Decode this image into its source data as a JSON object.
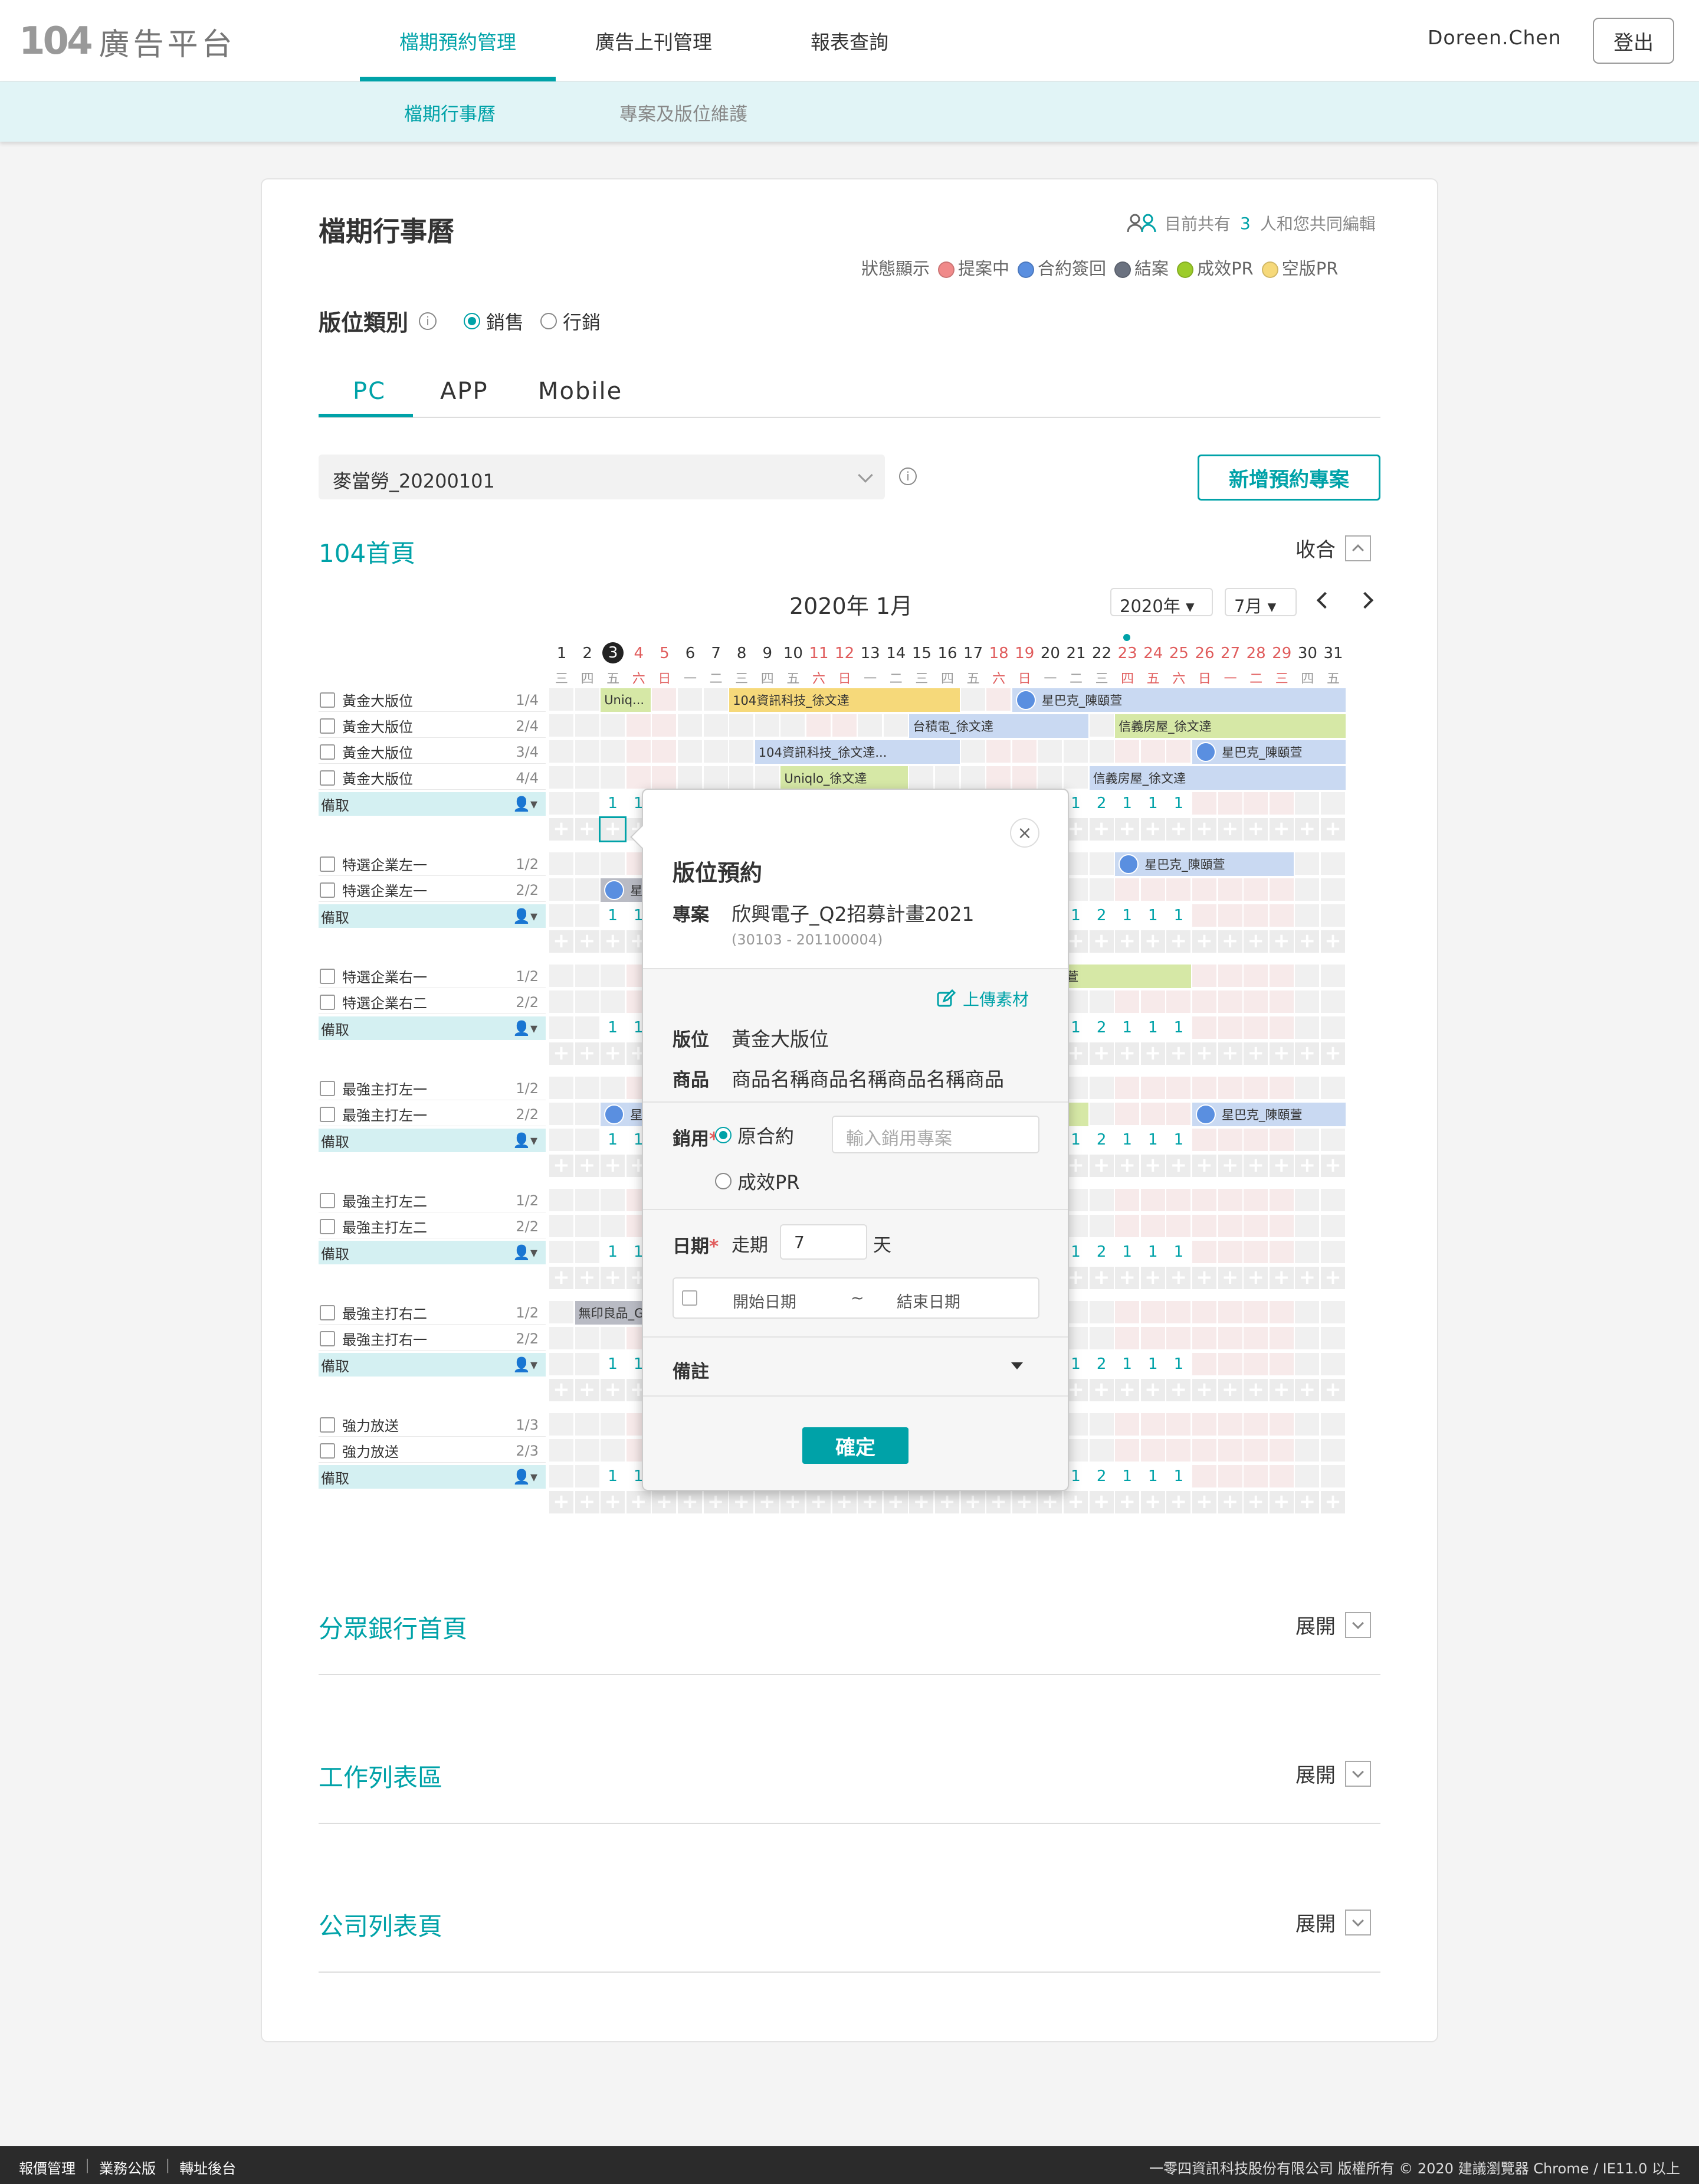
{
  "brand": {
    "num": "104",
    "name": "廣告平台"
  },
  "nav": {
    "items": [
      {
        "label": "檔期預約管理"
      },
      {
        "label": "廣告上刊管理"
      },
      {
        "label": "報表查詢"
      }
    ],
    "user": "Doreen.Chen",
    "logout": "登出"
  },
  "subnav": {
    "items": [
      {
        "label": "檔期行事曆"
      },
      {
        "label": "專案及版位維護"
      }
    ]
  },
  "page": {
    "title": "檔期行事曆",
    "collab_prefix": "目前共有",
    "collab_count": "3",
    "collab_suffix": "人和您共同編輯",
    "legend_title": "狀態顯示",
    "legend": [
      {
        "label": "提案中",
        "color": "#f08a8a"
      },
      {
        "label": "合約簽回",
        "color": "#5a8fe0"
      },
      {
        "label": "結案",
        "color": "#6b7280"
      },
      {
        "label": "成效PR",
        "color": "#9ccc2a"
      },
      {
        "label": "空版PR",
        "color": "#f6d97a"
      }
    ],
    "category_label": "版位類別",
    "category_options": [
      {
        "label": "銷售",
        "selected": true
      },
      {
        "label": "行銷",
        "selected": false
      }
    ],
    "tabs": [
      {
        "label": "PC"
      },
      {
        "label": "APP"
      },
      {
        "label": "Mobile"
      }
    ],
    "project_select": "麥當勞_20200101",
    "new_project": "新增預約專案"
  },
  "section": {
    "title": "104首頁",
    "toggle": "收合"
  },
  "calendar": {
    "title": "2020年 1月",
    "year": "2020年",
    "month": "7月",
    "days": [
      "1",
      "2",
      "3",
      "4",
      "5",
      "6",
      "7",
      "8",
      "9",
      "10",
      "11",
      "12",
      "13",
      "14",
      "15",
      "16",
      "17",
      "18",
      "19",
      "20",
      "21",
      "22",
      "23",
      "24",
      "25",
      "26",
      "27",
      "28",
      "29",
      "30",
      "31"
    ],
    "weekdays": [
      "三",
      "四",
      "五",
      "六",
      "日",
      "一",
      "二",
      "三",
      "四",
      "五",
      "六",
      "日",
      "一",
      "二",
      "三",
      "四",
      "五",
      "六",
      "日",
      "一",
      "二",
      "三",
      "四",
      "五",
      "六",
      "日",
      "一",
      "二",
      "三",
      "四",
      "五"
    ],
    "weekend": [
      3,
      4,
      10,
      11,
      17,
      18,
      22,
      23,
      24,
      25,
      26,
      27,
      28
    ],
    "today_index": 2,
    "groups": [
      {
        "rows": [
          {
            "name": "黃金大版位",
            "frac": "1/4"
          },
          {
            "name": "黃金大版位",
            "frac": "2/4"
          },
          {
            "name": "黃金大版位",
            "frac": "3/4"
          },
          {
            "name": "黃金大版位",
            "frac": "4/4"
          }
        ]
      },
      {
        "rows": [
          {
            "name": "特選企業左一",
            "frac": "1/2"
          },
          {
            "name": "特選企業左一",
            "frac": "2/2"
          }
        ]
      },
      {
        "rows": [
          {
            "name": "特選企業右一",
            "frac": "1/2"
          },
          {
            "name": "特選企業右二",
            "frac": "2/2"
          }
        ]
      },
      {
        "rows": [
          {
            "name": "最強主打左一",
            "frac": "1/2"
          },
          {
            "name": "最強主打左一",
            "frac": "2/2"
          }
        ]
      },
      {
        "rows": [
          {
            "name": "最強主打左二",
            "frac": "1/2"
          },
          {
            "name": "最強主打左二",
            "frac": "2/2"
          }
        ]
      },
      {
        "rows": [
          {
            "name": "最強主打右二",
            "frac": "1/2"
          },
          {
            "name": "最強主打右一",
            "frac": "2/2"
          }
        ]
      },
      {
        "rows": [
          {
            "name": "強力放送",
            "frac": "1/3"
          },
          {
            "name": "強力放送",
            "frac": "2/3"
          }
        ]
      }
    ],
    "spare_label": "備取",
    "spare_counts": [
      "1",
      "1",
      "2",
      "1",
      "1",
      "1"
    ],
    "bookings": [
      {
        "group": 0,
        "row": 0,
        "start": 3,
        "end": 4,
        "label": "Uniq...",
        "style": "b-g",
        "avatar": false
      },
      {
        "group": 0,
        "row": 0,
        "start": 8,
        "end": 16,
        "label": "104資訊科技_徐文達",
        "style": "b-y",
        "avatar": false
      },
      {
        "group": 0,
        "row": 0,
        "start": 19,
        "end": 31,
        "label": "星巴克_陳頤萱",
        "style": "b-b",
        "avatar": true
      },
      {
        "group": 0,
        "row": 1,
        "start": 15,
        "end": 21,
        "label": "台積電_徐文達",
        "style": "b-b",
        "avatar": false
      },
      {
        "group": 0,
        "row": 1,
        "start": 23,
        "end": 31,
        "label": "信義房屋_徐文達",
        "style": "b-g",
        "avatar": false
      },
      {
        "group": 0,
        "row": 2,
        "start": 9,
        "end": 16,
        "label": "104資訊科技_徐文達...",
        "style": "b-b",
        "avatar": false
      },
      {
        "group": 0,
        "row": 2,
        "start": 26,
        "end": 31,
        "label": "星巴克_陳頤萱",
        "style": "b-b",
        "avatar": true
      },
      {
        "group": 0,
        "row": 3,
        "start": 10,
        "end": 14,
        "label": "Uniqlo_徐文達",
        "style": "b-g",
        "avatar": false
      },
      {
        "group": 0,
        "row": 3,
        "start": 22,
        "end": 31,
        "label": "信義房屋_徐文達",
        "style": "b-b",
        "avatar": false
      },
      {
        "group": 1,
        "row": 0,
        "start": 23,
        "end": 29,
        "label": "星巴克_陳頤萱",
        "style": "b-b",
        "avatar": true
      },
      {
        "group": 1,
        "row": 1,
        "start": 3,
        "end": 4,
        "label": "星",
        "style": "b-d",
        "avatar": true
      },
      {
        "group": 2,
        "row": 0,
        "start": 20,
        "end": 25,
        "label": "陳頤萱",
        "style": "b-g",
        "avatar": false
      },
      {
        "group": 3,
        "row": 1,
        "start": 3,
        "end": 4,
        "label": "星",
        "style": "b-b",
        "avatar": true
      },
      {
        "group": 3,
        "row": 1,
        "start": 20,
        "end": 21,
        "label": "",
        "style": "b-g",
        "avatar": false
      },
      {
        "group": 3,
        "row": 1,
        "start": 26,
        "end": 31,
        "label": "星巴克_陳頤萱",
        "style": "b-b",
        "avatar": true
      },
      {
        "group": 5,
        "row": 0,
        "start": 2,
        "end": 4,
        "label": "無印良品_G",
        "style": "b-d",
        "avatar": false
      }
    ]
  },
  "popup": {
    "title": "版位預約",
    "project_label": "專案",
    "project_name": "欣興電子_Q2招募計畫2021",
    "project_code": "(30103 - 201100004)",
    "upload": "上傳素材",
    "slot_label": "版位",
    "slot_value": "黃金大版位",
    "product_label": "商品",
    "product_value": "商品名稱商品名稱商品名稱商品",
    "usage_label": "銷用",
    "usage_opts": [
      {
        "label": "原合約",
        "selected": true
      },
      {
        "label": "成效PR",
        "selected": false
      }
    ],
    "usage_placeholder": "輸入銷用專案",
    "date_label": "日期",
    "period_label": "走期",
    "period_value": "7",
    "period_unit": "天",
    "start_placeholder": "開始日期",
    "tilde": "~",
    "end_placeholder": "結束日期",
    "notes_label": "備註",
    "confirm": "確定",
    "close": "×"
  },
  "collapsed_sections": [
    {
      "title": "分眾銀行首頁",
      "toggle": "展開"
    },
    {
      "title": "工作列表區",
      "toggle": "展開"
    },
    {
      "title": "公司列表頁",
      "toggle": "展開"
    }
  ],
  "footer": {
    "links": [
      "報價管理",
      "業務公版",
      "轉址後台"
    ],
    "copyright": "一零四資訊科技股份有限公司 版權所有 © 2020 建議瀏覽器 Chrome / IE11.0 以上"
  }
}
